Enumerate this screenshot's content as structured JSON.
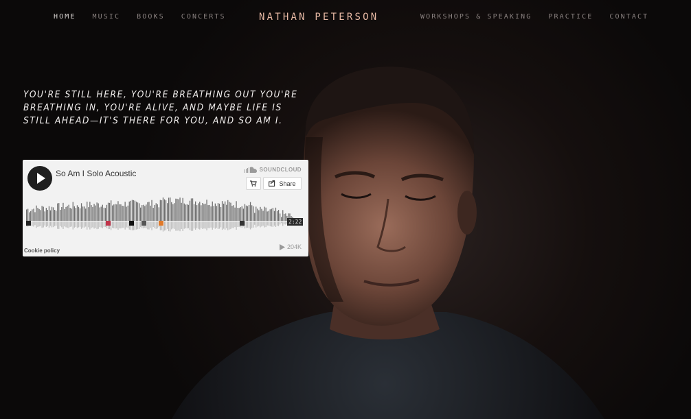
{
  "nav": {
    "left": [
      "Home",
      "Music",
      "Books",
      "Concerts"
    ],
    "title": "NATHAN PETERSON",
    "right": [
      "Workshops & Speaking",
      "Practice",
      "Contact"
    ],
    "active": "Home"
  },
  "hero": {
    "quote": "You're still here, you're breathing out you're breathing in, you're alive, and maybe life is still ahead—it's there for you, and so am I.",
    "background_color": "#0b0909"
  },
  "soundcloud": {
    "track_title": "So Am I Solo Acoustic",
    "brand": "SOUNDCLOUD",
    "share_label": "Share",
    "duration": "2:22",
    "cookie_policy": "Cookie policy",
    "plays": "204K",
    "icons": {
      "play": "play-icon",
      "brand": "soundcloud-cloud-icon",
      "cart": "cart-icon",
      "share": "share-icon",
      "plays": "play-count-icon"
    }
  },
  "colors": {
    "title_accent": "#e7b9a4",
    "nav_text": "#8a8280",
    "nav_active": "#d9d4d2",
    "widget_bg": "#f2f2f2"
  }
}
